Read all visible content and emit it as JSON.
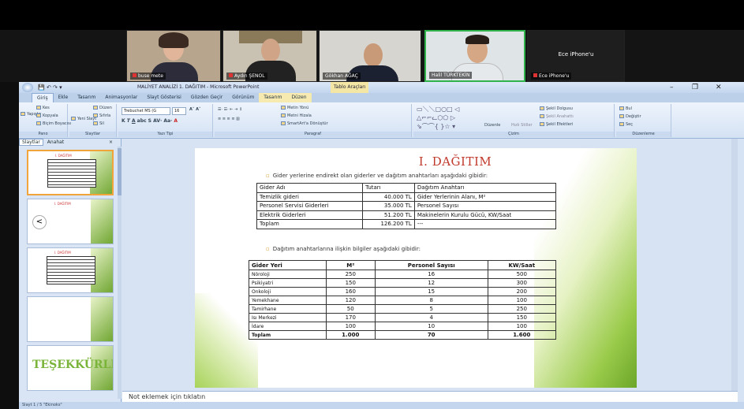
{
  "video": {
    "tiles": [
      {
        "name": "buse mete",
        "mic_muted": true
      },
      {
        "name": "Aydın ŞENOL",
        "mic_muted": true
      },
      {
        "name": "Gökhan AĞAÇ",
        "mic_muted": false
      },
      {
        "name": "Halil TÜRKTEKİN",
        "mic_muted": false,
        "active": true
      },
      {
        "name": "Ece iPhone'u",
        "center_label": "Ece iPhone'u",
        "mic_muted": true
      }
    ]
  },
  "window": {
    "title": "MALİYET ANALİZİ 1. DAĞITIM - Microsoft PowerPoint",
    "context_tab": "Tablo Araçları",
    "minimize": "–",
    "restore": "❐",
    "close": "✕"
  },
  "ribbon": {
    "tabs": [
      "Giriş",
      "Ekle",
      "Tasarım",
      "Animasyonlar",
      "Slayt Gösterisi",
      "Gözden Geçir",
      "Görünüm",
      "Tasarım",
      "Düzen"
    ],
    "selected_tab": "Giriş",
    "groups": {
      "pano": {
        "label": "Pano",
        "paste": "Yapıştır",
        "cut": "Kes",
        "copy": "Kopyala",
        "format_painter": "Biçim Boyacısı"
      },
      "slaytlar": {
        "label": "Slaytlar",
        "new_slide": "Yeni Slayt",
        "layout": "Düzen",
        "reset": "Sıfırla",
        "delete": "Sil"
      },
      "yazi_tipi": {
        "label": "Yazı Tipi",
        "font": "Trebuchet MS (G",
        "size": "16"
      },
      "paragraf": {
        "label": "Paragraf",
        "text_direction": "Metin Yönü",
        "align_text": "Metni Hizala",
        "smartart": "SmartArt'a Dönüştür"
      },
      "cizim": {
        "label": "Çizim",
        "arrange": "Düzenle",
        "quick_styles": "Hızlı Stiller",
        "shape_fill": "Şekil Dolgusu",
        "shape_outline": "Şekil Anahattı",
        "shape_effects": "Şekil Efektleri"
      },
      "duzenleme": {
        "label": "Düzenleme",
        "find": "Bul",
        "replace": "Değiştir",
        "select": "Seç"
      }
    }
  },
  "leftpane": {
    "tabs": [
      "Slaytlar",
      "Anahat"
    ],
    "close": "×",
    "thumbnails": [
      {
        "num": "1",
        "title": "I. DAĞITIM",
        "selected": true
      },
      {
        "num": "2",
        "title": "I. DAĞITIM",
        "selected": false
      },
      {
        "num": "3",
        "title": "I. DAĞITIM",
        "selected": false
      },
      {
        "num": "4",
        "title": "",
        "selected": false
      },
      {
        "num": "5",
        "title": "TEŞEKKÜRLER",
        "selected": false
      }
    ]
  },
  "slide": {
    "title": "I. DAĞITIM",
    "bullet1": "Gider yerlerine endirekt olan giderler ve dağıtım anahtarları aşağıdaki gibidir:",
    "bullet2": "Dağıtım anahtarlarına ilişkin bilgiler aşağıdaki gibidir:",
    "table1": {
      "headers": [
        "Gider Adı",
        "Tutarı",
        "Dağıtım Anahtarı"
      ],
      "rows": [
        [
          "Temizlik gideri",
          "40.000 TL",
          "Gider Yerlerinin Alanı, M²"
        ],
        [
          "Personel Servisi Giderleri",
          "35.000 TL",
          "Personel Sayısı"
        ],
        [
          "Elektrik Giderleri",
          "51.200 TL",
          "Makinelerin Kurulu Gücü, KW/Saat"
        ],
        [
          "Toplam",
          "126.200 TL",
          "---"
        ]
      ]
    },
    "table2": {
      "headers": [
        "Gider Yeri",
        "M²",
        "Personel Sayısı",
        "KW/Saat"
      ],
      "rows": [
        [
          "Nöroloji",
          "250",
          "16",
          "500"
        ],
        [
          "Psikiyatri",
          "150",
          "12",
          "300"
        ],
        [
          "Onkoloji",
          "160",
          "15",
          "200"
        ],
        [
          "Yemekhane",
          "120",
          "8",
          "100"
        ],
        [
          "Tamirhane",
          "50",
          "5",
          "250"
        ],
        [
          "Isı Merkezi",
          "170",
          "4",
          "150"
        ],
        [
          "İdare",
          "100",
          "10",
          "100"
        ]
      ],
      "total": [
        "Toplam",
        "1.000",
        "70",
        "1.600"
      ]
    }
  },
  "notes": {
    "placeholder": "Not eklemek için tıklatın"
  },
  "status": {
    "text": "Slayt 1 / 5   \"Ekinoks\""
  }
}
